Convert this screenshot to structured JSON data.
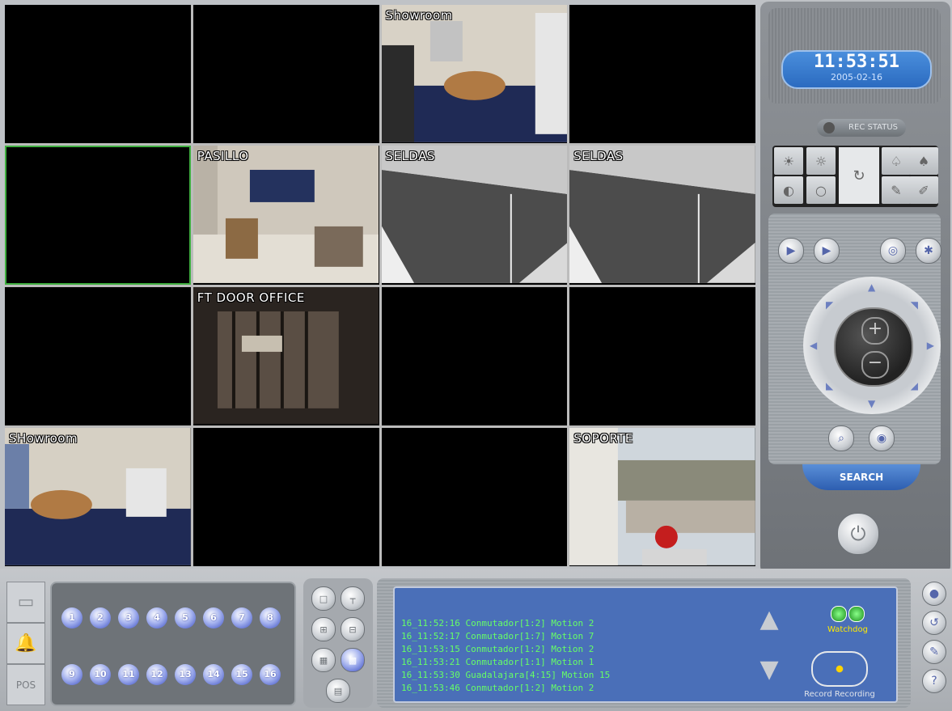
{
  "cameras": [
    {
      "label": ""
    },
    {
      "label": ""
    },
    {
      "label": "Showroom"
    },
    {
      "label": ""
    },
    {
      "label": ""
    },
    {
      "label": "PASILLO"
    },
    {
      "label": "SELDAS"
    },
    {
      "label": "SELDAS"
    },
    {
      "label": ""
    },
    {
      "label": "FT DOOR OFFICE"
    },
    {
      "label": ""
    },
    {
      "label": ""
    },
    {
      "label": "SHowroom"
    },
    {
      "label": ""
    },
    {
      "label": ""
    },
    {
      "label": "SOPORTE"
    }
  ],
  "clock": {
    "time": "11:53:51",
    "date": "2005-02-16"
  },
  "panel": {
    "rec_status": "REC STATUS",
    "search_label": "SEARCH"
  },
  "camera_numbers": [
    "1",
    "2",
    "3",
    "4",
    "5",
    "6",
    "7",
    "8",
    "9",
    "10",
    "11",
    "12",
    "13",
    "14",
    "15",
    "16"
  ],
  "side_tabs": {
    "pos_label": "POS"
  },
  "log_lines": [
    "16_11:52:16 Conmutador[1:2] Motion 2",
    "16_11:52:17 Conmutador[1:7] Motion 7",
    "16_11:53:15 Conmutador[1:2] Motion 2",
    "16_11:53:21 Conmutador[1:1] Motion 1",
    "16_11:53:30 Guadalajara[4:15] Motion 15",
    "16_11:53:46 Conmutador[1:2] Motion 2"
  ],
  "watchdog_label": "Watchdog",
  "record_label": "Record Recording",
  "colors": {
    "selected_cell": "#3fae3f",
    "log_text": "#66ff66",
    "accent_blue": "#3b4fc4"
  }
}
